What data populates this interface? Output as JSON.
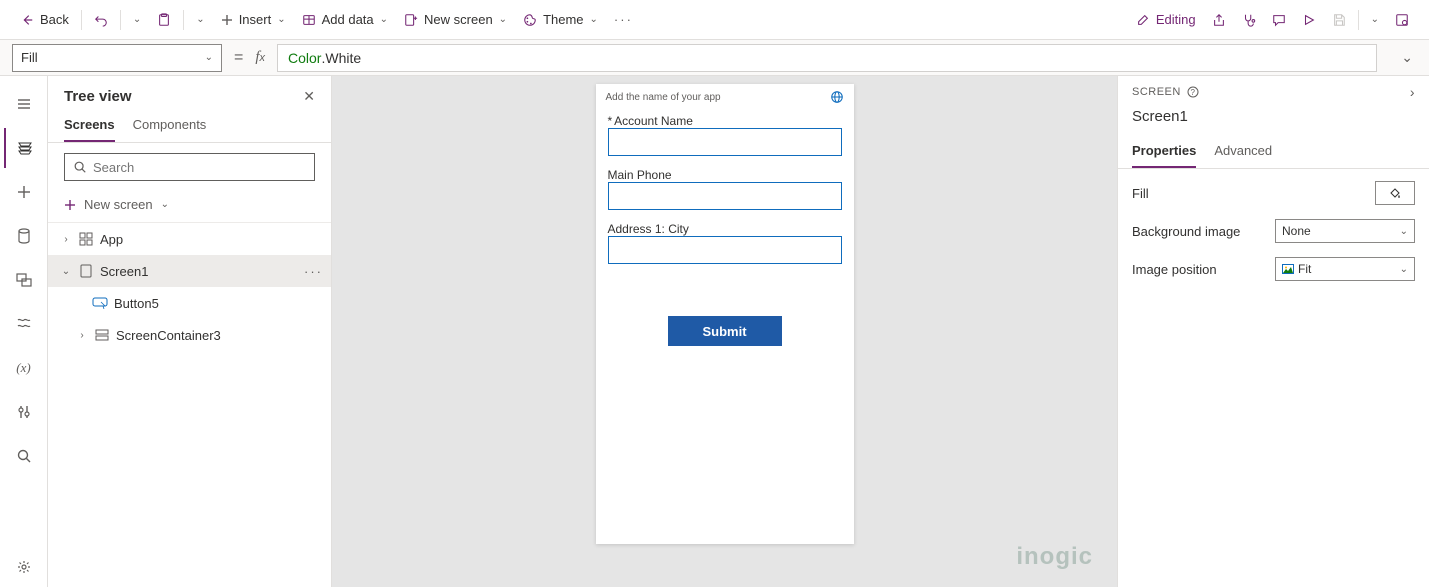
{
  "toolbar": {
    "back": "Back",
    "insert": "Insert",
    "add_data": "Add data",
    "new_screen": "New screen",
    "theme": "Theme",
    "editing": "Editing"
  },
  "formula": {
    "property": "Fill",
    "value_obj": "Color",
    "value_prop": ".White"
  },
  "tree": {
    "title": "Tree view",
    "tabs": {
      "screens": "Screens",
      "components": "Components"
    },
    "search_placeholder": "Search",
    "new_screen": "New screen",
    "items": {
      "app": "App",
      "screen1": "Screen1",
      "button5": "Button5",
      "screencontainer3": "ScreenContainer3"
    }
  },
  "canvas": {
    "header_text": "Add the name of your app",
    "fields": {
      "account_name": "Account Name",
      "main_phone": "Main Phone",
      "city": "Address 1: City"
    },
    "submit": "Submit"
  },
  "panel": {
    "header": "SCREEN",
    "title": "Screen1",
    "tabs": {
      "properties": "Properties",
      "advanced": "Advanced"
    },
    "rows": {
      "fill": "Fill",
      "bg_image": "Background image",
      "bg_image_value": "None",
      "img_pos": "Image position",
      "img_pos_value": "Fit"
    }
  },
  "watermark": "inogic"
}
